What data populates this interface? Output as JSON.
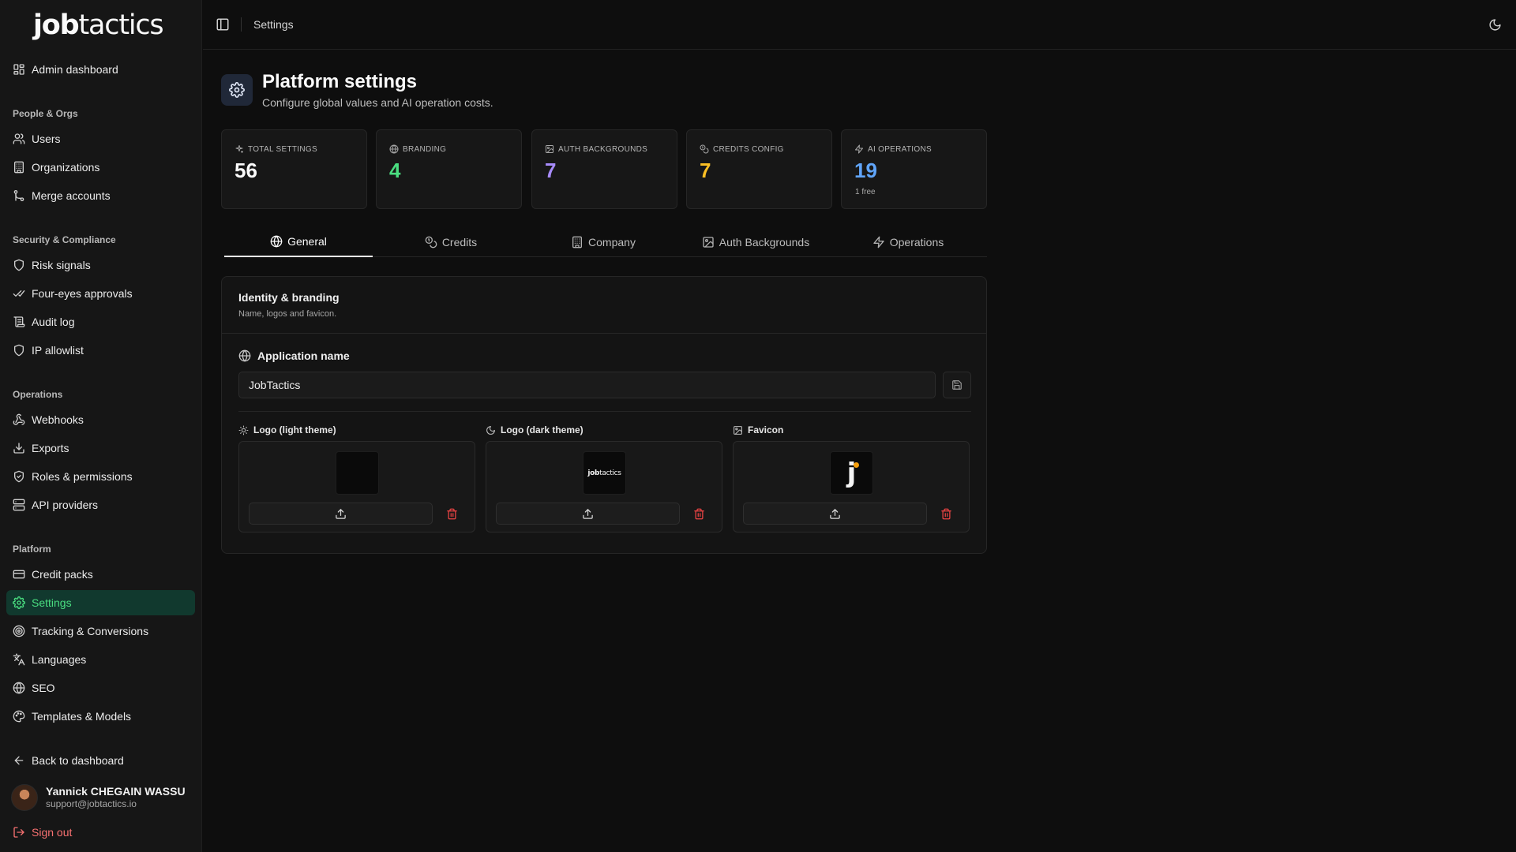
{
  "brand": {
    "part1": "job",
    "part2": "tactics"
  },
  "sidebar": {
    "top_item": {
      "label": "Admin dashboard",
      "icon": "grid-icon"
    },
    "groups": [
      {
        "label": "People & Orgs",
        "items": [
          {
            "label": "Users",
            "icon": "users-icon"
          },
          {
            "label": "Organizations",
            "icon": "building-icon"
          },
          {
            "label": "Merge accounts",
            "icon": "merge-icon"
          }
        ]
      },
      {
        "label": "Security & Compliance",
        "items": [
          {
            "label": "Risk signals",
            "icon": "shield-icon"
          },
          {
            "label": "Four-eyes approvals",
            "icon": "double-check-icon"
          },
          {
            "label": "Audit log",
            "icon": "scroll-icon"
          },
          {
            "label": "IP allowlist",
            "icon": "shield-icon"
          }
        ]
      },
      {
        "label": "Operations",
        "items": [
          {
            "label": "Webhooks",
            "icon": "webhook-icon"
          },
          {
            "label": "Exports",
            "icon": "download-icon"
          },
          {
            "label": "Roles & permissions",
            "icon": "shield-check-icon"
          },
          {
            "label": "API providers",
            "icon": "server-icon"
          }
        ]
      },
      {
        "label": "Platform",
        "items": [
          {
            "label": "Credit packs",
            "icon": "credit-card-icon"
          },
          {
            "label": "Settings",
            "icon": "gear-icon",
            "active": true
          },
          {
            "label": "Tracking & Conversions",
            "icon": "target-icon"
          },
          {
            "label": "Languages",
            "icon": "languages-icon"
          },
          {
            "label": "SEO",
            "icon": "globe-icon"
          },
          {
            "label": "Templates & Models",
            "icon": "palette-icon"
          }
        ]
      }
    ],
    "back": {
      "label": "Back to dashboard",
      "icon": "arrow-left-icon"
    },
    "user": {
      "name": "Yannick CHEGAIN WASSU",
      "email": "support@jobtactics.io"
    },
    "signout": {
      "label": "Sign out",
      "icon": "logout-icon"
    }
  },
  "topbar": {
    "breadcrumb": "Settings"
  },
  "header": {
    "title": "Platform settings",
    "subtitle": "Configure global values and AI operation costs."
  },
  "stats": [
    {
      "label": "Total settings",
      "value": "56",
      "color": "#fafafa",
      "icon": "sparkle-icon"
    },
    {
      "label": "Branding",
      "value": "4",
      "color": "#4ade80",
      "icon": "globe-icon"
    },
    {
      "label": "Auth backgrounds",
      "value": "7",
      "color": "#a78bfa",
      "icon": "image-icon"
    },
    {
      "label": "Credits config",
      "value": "7",
      "color": "#fbbf24",
      "icon": "coins-icon"
    },
    {
      "label": "AI operations",
      "value": "19",
      "color": "#60a5fa",
      "icon": "zap-icon",
      "sub": "1 free"
    }
  ],
  "tabs": [
    {
      "label": "General",
      "icon": "globe-icon",
      "active": true
    },
    {
      "label": "Credits",
      "icon": "coins-icon"
    },
    {
      "label": "Company",
      "icon": "building-icon"
    },
    {
      "label": "Auth Backgrounds",
      "icon": "image-icon"
    },
    {
      "label": "Operations",
      "icon": "zap-icon"
    }
  ],
  "card": {
    "title": "Identity & branding",
    "subtitle": "Name, logos and favicon.",
    "app_name_label": "Application name",
    "app_name_value": "JobTactics",
    "logos": [
      {
        "label": "Logo (light theme)",
        "icon": "sun-icon"
      },
      {
        "label": "Logo (dark theme)",
        "icon": "moon-icon"
      },
      {
        "label": "Favicon",
        "icon": "image-icon"
      }
    ],
    "dark_logo_text": {
      "part1": "job",
      "part2": "tactics"
    },
    "favicon_letter": "j"
  }
}
